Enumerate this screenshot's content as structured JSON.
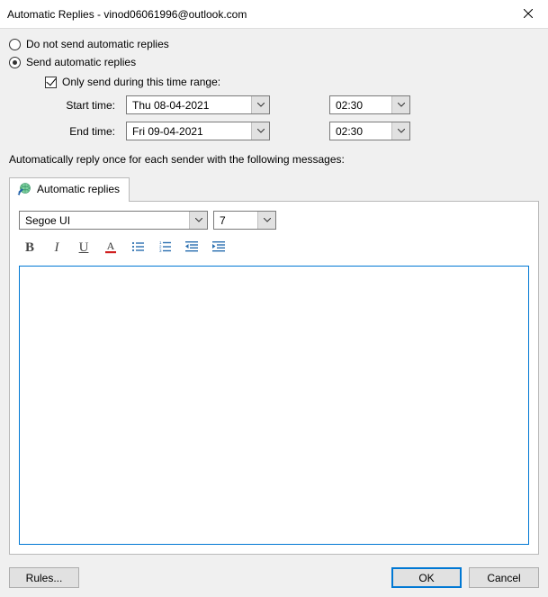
{
  "window": {
    "title": "Automatic Replies - vinod06061996@outlook.com"
  },
  "options": {
    "do_not_send": "Do not send automatic replies",
    "send": "Send automatic replies",
    "selected": "send"
  },
  "timerange": {
    "checkbox_label": "Only send during this time range:",
    "checked": true,
    "start_label": "Start time:",
    "end_label": "End time:",
    "start_date": "Thu 08-04-2021",
    "start_time": "02:30",
    "end_date": "Fri 09-04-2021",
    "end_time": "02:30"
  },
  "info": "Automatically reply once for each sender with the following messages:",
  "tab": {
    "label": "Automatic replies"
  },
  "editor": {
    "font": "Segoe UI",
    "size": "7",
    "bold": "B",
    "italic": "I",
    "underline": "U",
    "content": ""
  },
  "buttons": {
    "rules": "Rules...",
    "ok": "OK",
    "cancel": "Cancel"
  }
}
